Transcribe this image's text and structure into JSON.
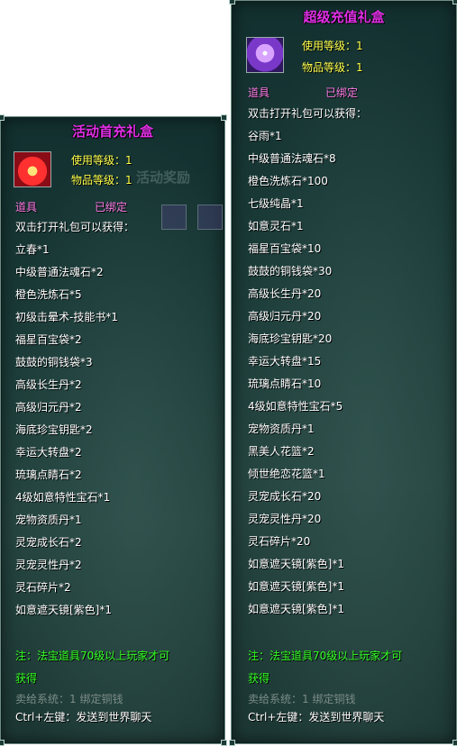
{
  "left_tooltip": {
    "title": "活动首充礼盒",
    "use_level": "使用等级：1",
    "item_level": "物品等级：1",
    "category": "道具",
    "bind_status": "已绑定",
    "intro": "双击打开礼包可以获得：",
    "items": [
      "立春*1",
      "中级普通法魂石*2",
      "橙色洗炼石*5",
      "初级击晕术-技能书*1",
      "福星百宝袋*2",
      "鼓鼓的铜钱袋*3",
      "高级长生丹*2",
      "高级归元丹*2",
      "海底珍宝钥匙*2",
      "幸运大转盘*2",
      "琉璃点睛石*2",
      "4级如意特性宝石*1",
      "宠物资质丹*1",
      "灵宠成长石*2",
      "灵宠灵性丹*2",
      "灵石碎片*2",
      "如意遮天镜[紫色]*1"
    ],
    "note_line1": "注：法宝道具70级以上玩家才可",
    "note_line2": "获得",
    "sell_info": "卖给系统：1 绑定铜钱",
    "chat_hint": "Ctrl+左键：发送到世界聊天"
  },
  "right_tooltip": {
    "title": "超级充值礼盒",
    "use_level": "使用等级：1",
    "item_level": "物品等级：1",
    "category": "道具",
    "bind_status": "已绑定",
    "intro": "双击打开礼包可以获得：",
    "items": [
      "谷雨*1",
      "中级普通法魂石*8",
      "橙色洗炼石*100",
      "七级纯晶*1",
      "如意灵石*1",
      "福星百宝袋*10",
      "鼓鼓的铜钱袋*30",
      "高级长生丹*20",
      "高级归元丹*20",
      "海底珍宝钥匙*20",
      "幸运大转盘*15",
      "琉璃点睛石*10",
      "4级如意特性宝石*5",
      "宠物资质丹*1",
      "黑美人花篮*2",
      "倾世绝恋花篮*1",
      "灵宠成长石*20",
      "灵宠灵性丹*20",
      "灵石碎片*20",
      "如意遮天镜[紫色]*1",
      "如意遮天镜[紫色]*1",
      "如意遮天镜[紫色]*1"
    ],
    "note_line1": "注：法宝道具70级以上玩家才可",
    "note_line2": "获得",
    "sell_info": "卖给系统：1 绑定铜钱",
    "chat_hint": "Ctrl+左键：发送到世界聊天"
  },
  "background_text": {
    "left_banner": "活动奖励"
  },
  "colors": {
    "title": "#e12fe6",
    "stat": "#ffff4a",
    "tag": "#ff7ce8",
    "note": "#33ff22"
  }
}
